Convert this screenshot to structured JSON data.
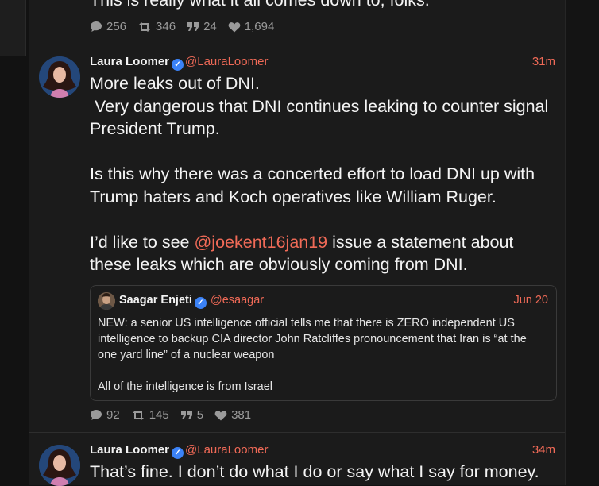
{
  "colors": {
    "accent": "#f06a57",
    "verified": "#3b82f6",
    "background": "#1b1b1b",
    "muted": "#9a9a9a"
  },
  "top_tweet": {
    "text": "This is really what it all comes down to, folks.",
    "stats": {
      "replies": "256",
      "retweets": "346",
      "quotes": "24",
      "likes": "1,694"
    }
  },
  "tweet1": {
    "name": "Laura Loomer",
    "handle": "@LauraLoomer",
    "time": "31m",
    "text_part1": "More leaks out of DNI.\n Very dangerous that DNI continues leaking to counter signal President Trump.\n\nIs this why there was a concerted effort to load DNI up with Trump haters and Koch operatives like William Ruger.\n\nI’d like to see ",
    "mention": "@joekent16jan19",
    "text_part2": " issue a statement about these leaks which are obviously coming from DNI.",
    "quote": {
      "name": "Saagar Enjeti",
      "handle": "@esaagar",
      "time": "Jun 20",
      "text": "NEW: a senior US intelligence official tells me that there is ZERO independent US intelligence to backup CIA director John Ratcliffes pronouncement that Iran is “at the one yard line” of a nuclear weapon\n\nAll of the intelligence is from Israel"
    },
    "stats": {
      "replies": "92",
      "retweets": "145",
      "quotes": "5",
      "likes": "381"
    }
  },
  "tweet2": {
    "name": "Laura Loomer",
    "handle": "@LauraLoomer",
    "time": "34m",
    "text": "That’s fine. I don’t do what I do or say what I say for money."
  },
  "icons": {
    "reply": "comment-icon",
    "retweet": "retweet-icon",
    "quote": "quote-icon",
    "like": "heart-icon",
    "verified": "verified-check-icon"
  }
}
